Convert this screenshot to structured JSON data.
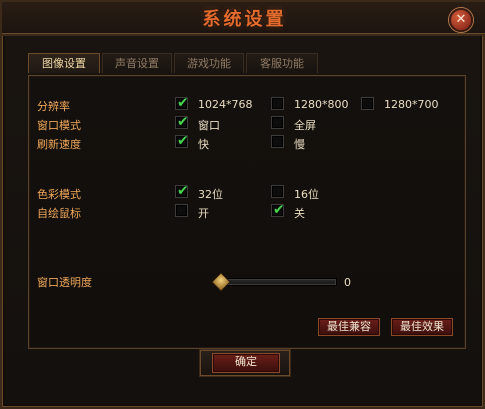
{
  "window": {
    "title": "系统设置",
    "close_icon": "close-icon"
  },
  "tabs": [
    {
      "label": "图像设置",
      "active": true
    },
    {
      "label": "声音设置",
      "active": false
    },
    {
      "label": "游戏功能",
      "active": false
    },
    {
      "label": "客服功能",
      "active": false
    }
  ],
  "settings": {
    "resolution": {
      "label": "分辨率",
      "options": [
        {
          "text": "1024*768",
          "checked": true
        },
        {
          "text": "1280*800",
          "checked": false
        },
        {
          "text": "1280*700",
          "checked": false
        }
      ]
    },
    "window_mode": {
      "label": "窗口模式",
      "options": [
        {
          "text": "窗口",
          "checked": true
        },
        {
          "text": "全屏",
          "checked": false
        }
      ]
    },
    "refresh_speed": {
      "label": "刷新速度",
      "options": [
        {
          "text": "快",
          "checked": true
        },
        {
          "text": "慢",
          "checked": false
        }
      ]
    },
    "color_mode": {
      "label": "色彩模式",
      "options": [
        {
          "text": "32位",
          "checked": true
        },
        {
          "text": "16位",
          "checked": false
        }
      ]
    },
    "custom_cursor": {
      "label": "自绘鼠标",
      "options": [
        {
          "text": "开",
          "checked": false
        },
        {
          "text": "关",
          "checked": true
        }
      ]
    },
    "window_opacity": {
      "label": "窗口透明度",
      "value_text": "0",
      "value_fraction": 0.0
    }
  },
  "buttons": {
    "best_compat": "最佳兼容",
    "best_effect": "最佳效果",
    "ok": "确定"
  },
  "colors": {
    "title": "#e36b2d",
    "label": "#f0a85a",
    "text": "#eadcc2",
    "check": "#47d34c",
    "button_bg": "#5a1a15"
  }
}
